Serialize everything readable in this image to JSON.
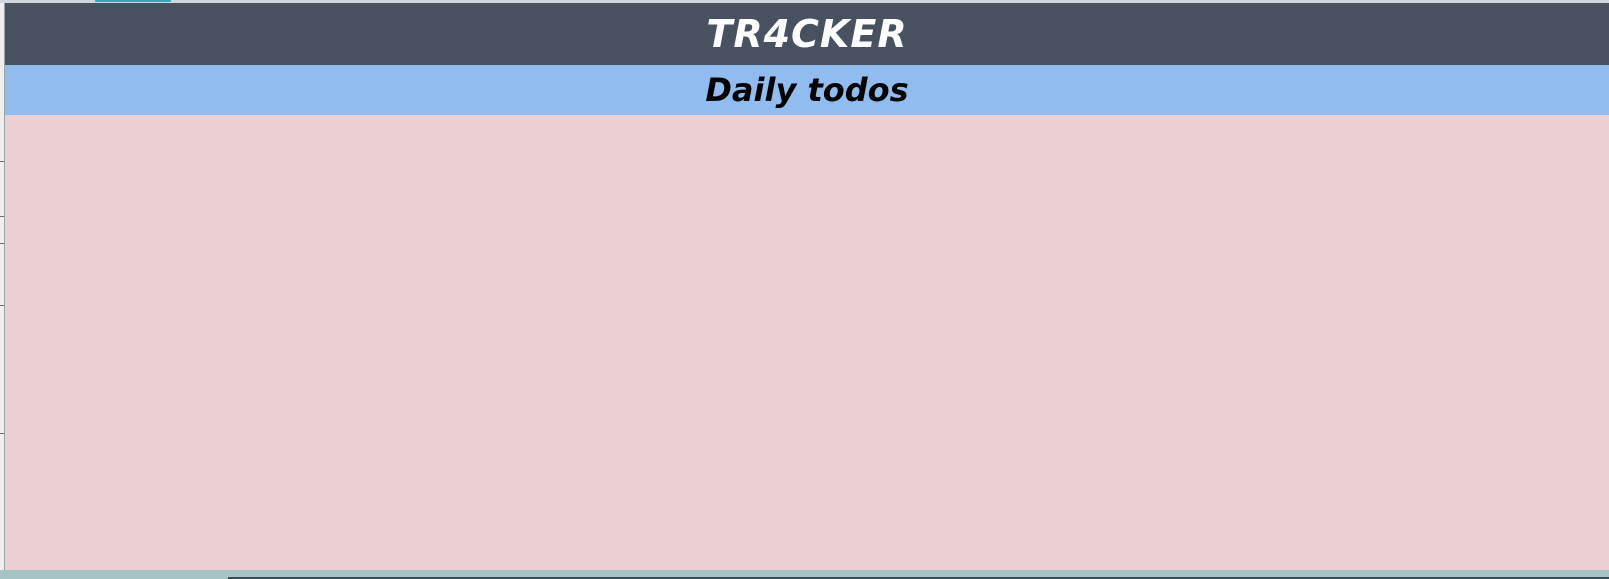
{
  "header": {
    "title": "TR4CKER"
  },
  "section": {
    "title": "Daily todos"
  },
  "todos": [],
  "colors": {
    "header_bg": "#475160",
    "section_bg": "#90bcef",
    "list_bg": "#ebcfd2",
    "header_text": "#ffffff",
    "section_text": "#000000"
  }
}
